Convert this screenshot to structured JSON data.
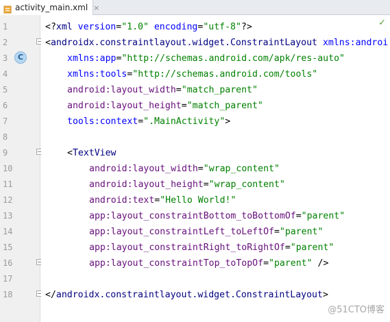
{
  "tab": {
    "label": "activity_main.xml",
    "close": "×"
  },
  "status_icon": "check-icon",
  "gutter_badge": "C",
  "line_numbers": [
    "1",
    "2",
    "3",
    "4",
    "5",
    "6",
    "7",
    "8",
    "9",
    "10",
    "11",
    "12",
    "13",
    "14",
    "15",
    "16",
    "17",
    "18"
  ],
  "code": {
    "l1": {
      "a": "<?",
      "b": "xml ",
      "c": "version",
      "d": "=",
      "e": "\"1.0\"",
      "f": " encoding",
      "g": "=",
      "h": "\"utf-8\"",
      "i": "?>"
    },
    "l2": {
      "a": "<",
      "b": "androidx.constraintlayout.widget.ConstraintLayout ",
      "c": "xmlns:androi"
    },
    "l3": {
      "a": "xmlns:app",
      "b": "=",
      "c": "\"http://schemas.android.com/apk/res-auto\""
    },
    "l4": {
      "a": "xmlns:tools",
      "b": "=",
      "c": "\"http://schemas.android.com/tools\""
    },
    "l5": {
      "a": "android:layout_width",
      "b": "=",
      "c": "\"match_parent\""
    },
    "l6": {
      "a": "android:layout_height",
      "b": "=",
      "c": "\"match_parent\""
    },
    "l7": {
      "a": "tools:context",
      "b": "=",
      "c": "\".MainActivity\"",
      "d": ">"
    },
    "l9": {
      "a": "<",
      "b": "TextView"
    },
    "l10": {
      "a": "android:layout_width",
      "b": "=",
      "c": "\"wrap_content\""
    },
    "l11": {
      "a": "android:layout_height",
      "b": "=",
      "c": "\"wrap_content\""
    },
    "l12": {
      "a": "android:text",
      "b": "=",
      "c": "\"Hello World!\""
    },
    "l13": {
      "a": "app:layout_constraintBottom_toBottomOf",
      "b": "=",
      "c": "\"parent\""
    },
    "l14": {
      "a": "app:layout_constraintLeft_toLeftOf",
      "b": "=",
      "c": "\"parent\""
    },
    "l15": {
      "a": "app:layout_constraintRight_toRightOf",
      "b": "=",
      "c": "\"parent\""
    },
    "l16": {
      "a": "app:layout_constraintTop_toTopOf",
      "b": "=",
      "c": "\"parent\"",
      "d": " />"
    },
    "l18": {
      "a": "</",
      "b": "androidx.constraintlayout.widget.ConstraintLayout",
      "c": ">"
    }
  },
  "watermark": "@51CTO博客"
}
